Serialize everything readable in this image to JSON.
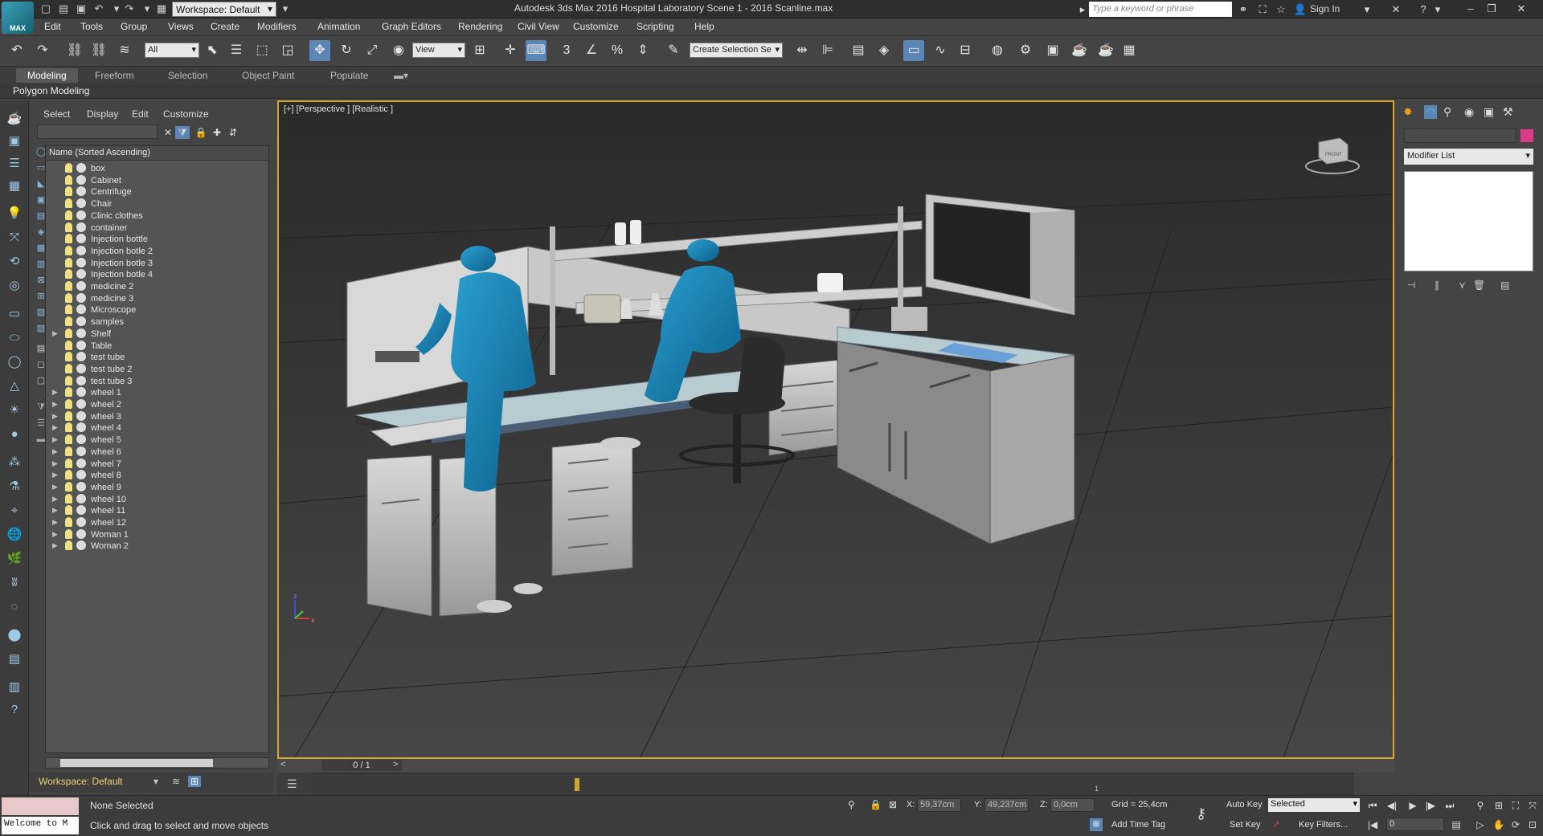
{
  "title_bar": {
    "app_title": "Autodesk 3ds Max 2016     Hospital Laboratory Scene 1 - 2016 Scanline.max",
    "workspace": "Workspace: Default",
    "search_placeholder": "Type a keyword or phrase",
    "sign_in": "Sign In",
    "logo_text": "MAX"
  },
  "menu": [
    "Edit",
    "Tools",
    "Group",
    "Views",
    "Create",
    "Modifiers",
    "Animation",
    "Graph Editors",
    "Rendering",
    "Civil View",
    "Customize",
    "Scripting",
    "Help"
  ],
  "toolbar": {
    "selection_filter": "All",
    "reference_coord": "View",
    "named_selection": "Create Selection Se"
  },
  "ribbon": {
    "tabs": [
      "Modeling",
      "Freeform",
      "Selection",
      "Object Paint",
      "Populate"
    ],
    "active_tab": "Modeling",
    "panel_label": "Polygon Modeling"
  },
  "scene_explorer": {
    "menu": [
      "Select",
      "Display",
      "Edit",
      "Customize"
    ],
    "column_header": "Name (Sorted Ascending)",
    "items": [
      {
        "name": "box",
        "expandable": false
      },
      {
        "name": "Cabinet",
        "expandable": false
      },
      {
        "name": "Centrifuge",
        "expandable": false
      },
      {
        "name": "Chair",
        "expandable": false
      },
      {
        "name": "Clinic clothes",
        "expandable": false
      },
      {
        "name": "container",
        "expandable": false
      },
      {
        "name": "Injection bottle",
        "expandable": false
      },
      {
        "name": "Injection botle 2",
        "expandable": false
      },
      {
        "name": "Injection botle 3",
        "expandable": false
      },
      {
        "name": "Injection botle 4",
        "expandable": false
      },
      {
        "name": "medicine 2",
        "expandable": false
      },
      {
        "name": "medicine 3",
        "expandable": false
      },
      {
        "name": "Microscope",
        "expandable": false
      },
      {
        "name": "samples",
        "expandable": false
      },
      {
        "name": "Shelf",
        "expandable": true
      },
      {
        "name": "Table",
        "expandable": false
      },
      {
        "name": "test tube",
        "expandable": false
      },
      {
        "name": "test tube 2",
        "expandable": false
      },
      {
        "name": "test tube 3",
        "expandable": false
      },
      {
        "name": "wheel 1",
        "expandable": true
      },
      {
        "name": "wheel 2",
        "expandable": true
      },
      {
        "name": "wheel 3",
        "expandable": true
      },
      {
        "name": "wheel 4",
        "expandable": true
      },
      {
        "name": "wheel 5",
        "expandable": true
      },
      {
        "name": "wheel 6",
        "expandable": true
      },
      {
        "name": "wheel 7",
        "expandable": true
      },
      {
        "name": "wheel 8",
        "expandable": true
      },
      {
        "name": "wheel 9",
        "expandable": true
      },
      {
        "name": "wheel 10",
        "expandable": true
      },
      {
        "name": "wheel 11",
        "expandable": true
      },
      {
        "name": "wheel 12",
        "expandable": true
      },
      {
        "name": "Woman 1",
        "expandable": true
      },
      {
        "name": "Woman 2",
        "expandable": true
      }
    ],
    "workspace_label": "Workspace: Default"
  },
  "viewport": {
    "label": "[+] [Perspective ] [Realistic ]",
    "viewcube_label": "FRONT",
    "axis_labels": [
      "z",
      "x"
    ]
  },
  "timeline": {
    "frame_counter": "0 / 1",
    "track_tick": "1"
  },
  "command_panel": {
    "modifier_list": "Modifier List"
  },
  "status_bar": {
    "maxscript_text": "Welcome to M",
    "selection_status": "None Selected",
    "prompt": "Click and drag to select and move objects",
    "x_label": "X:",
    "x_value": "59,37cm",
    "y_label": "Y:",
    "y_value": "49,237cm",
    "z_label": "Z:",
    "z_value": "0,0cm",
    "grid": "Grid = 25,4cm",
    "add_time_tag": "Add Time Tag",
    "auto_key": "Auto Key",
    "set_key": "Set Key",
    "key_mode": "Selected",
    "key_filters": "Key Filters...",
    "current_frame": "0"
  }
}
